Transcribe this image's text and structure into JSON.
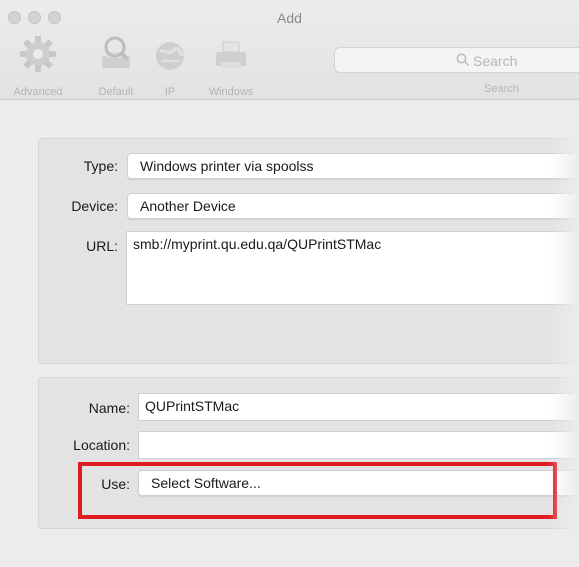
{
  "window": {
    "title": "Add"
  },
  "toolbar": {
    "items": [
      {
        "label": "Advanced",
        "icon": "gear-icon"
      },
      {
        "label": "Default",
        "icon": "printer-magnifier-icon"
      },
      {
        "label": "IP",
        "icon": "globe-icon"
      },
      {
        "label": "Windows",
        "icon": "printer-icon"
      }
    ],
    "search": {
      "placeholder": "Search",
      "label": "Search"
    }
  },
  "connection": {
    "type_label": "Type:",
    "type_value": "Windows printer via spoolss",
    "device_label": "Device:",
    "device_value": "Another Device",
    "url_label": "URL:",
    "url_value": "smb://myprint.qu.edu.qa/QUPrintSTMac"
  },
  "details": {
    "name_label": "Name:",
    "name_value": "QUPrintSTMac",
    "location_label": "Location:",
    "location_value": "",
    "use_label": "Use:",
    "use_value": "Select Software..."
  },
  "colors": {
    "highlight": "#e11b22"
  }
}
